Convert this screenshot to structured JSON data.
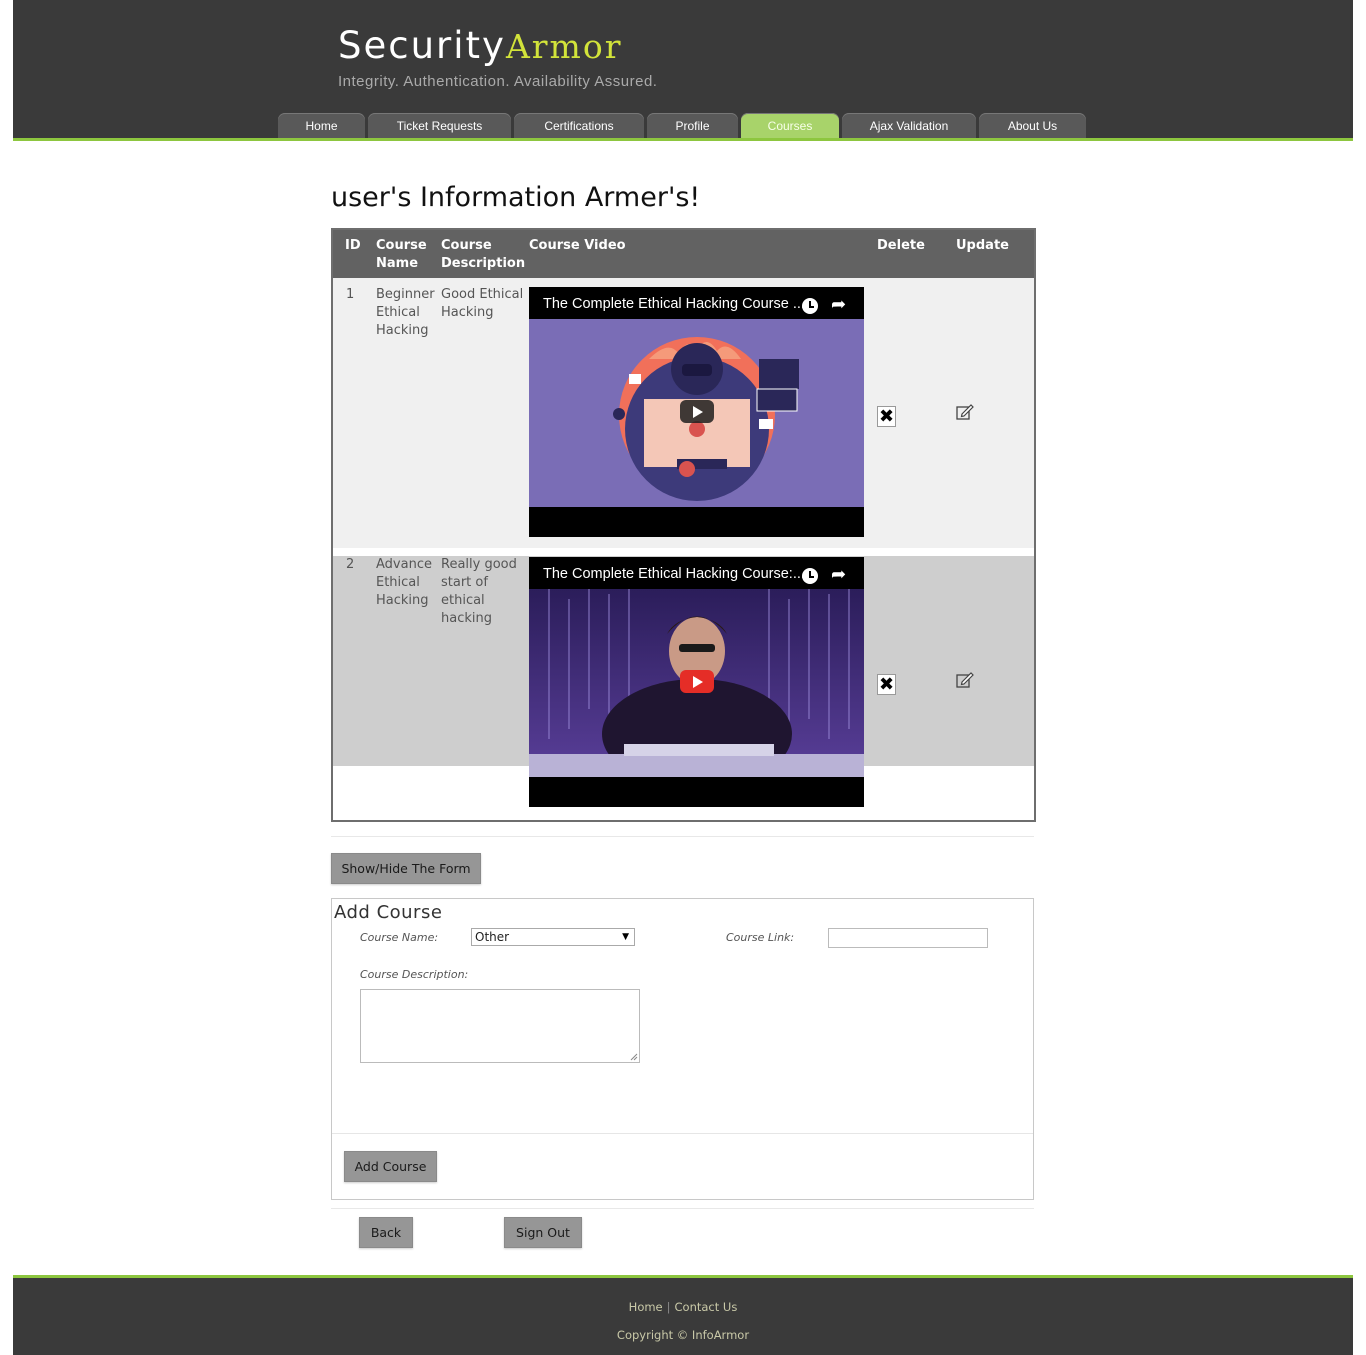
{
  "brand": {
    "part1": "Security",
    "part2": "Armor",
    "tagline": "Integrity. Authentication. Availability Assured."
  },
  "nav": [
    {
      "label": "Home",
      "active": false
    },
    {
      "label": "Ticket Requests",
      "active": false
    },
    {
      "label": "Certifications",
      "active": false
    },
    {
      "label": "Profile",
      "active": false
    },
    {
      "label": "Courses",
      "active": true
    },
    {
      "label": "Ajax Validation",
      "active": false
    },
    {
      "label": "About Us",
      "active": false
    }
  ],
  "page_title": "user's Information Armer's!",
  "table": {
    "headers": {
      "id": "ID",
      "course_name": [
        "Course",
        "Name"
      ],
      "course_description": [
        "Course",
        "Description"
      ],
      "course_video": "Course Video",
      "delete": "Delete",
      "update": "Update"
    },
    "rows": [
      {
        "id": "1",
        "name": [
          "Beginner",
          "Ethical",
          "Hacking"
        ],
        "description": [
          "Good Ethical",
          "Hacking"
        ],
        "video_title": "The Complete Ethical Hacking Course ..."
      },
      {
        "id": "2",
        "name": [
          "Advance",
          "Ethical",
          "Hacking"
        ],
        "description": [
          "Really good",
          "start of",
          "ethical",
          "hacking"
        ],
        "video_title": "The Complete Ethical Hacking Course:..."
      }
    ]
  },
  "buttons": {
    "toggle_form": "Show/Hide The Form",
    "add_course": "Add Course",
    "back": "Back",
    "sign_out": "Sign Out"
  },
  "form": {
    "title": "Add Course",
    "course_name_label": "Course Name:",
    "course_name_selected": "Other",
    "course_link_label": "Course Link:",
    "course_link_value": "",
    "course_description_label": "Course Description:",
    "course_description_value": ""
  },
  "footer": {
    "links": [
      "Home",
      "Contact Us"
    ],
    "copyright": "Copyright © InfoArmor"
  },
  "colors": {
    "header_bg": "#3a3a3a",
    "accent_green": "#8dc63f",
    "active_tab": "#a8d36a",
    "brand_yellow": "#d2e33a"
  }
}
